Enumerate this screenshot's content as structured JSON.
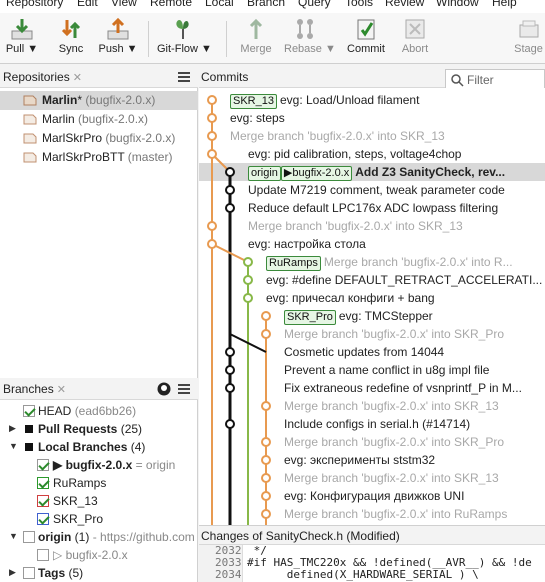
{
  "menu": [
    "Repository",
    "Edit",
    "View",
    "Remote",
    "Local",
    "Branch",
    "Query",
    "Tools",
    "Review",
    "Window",
    "Help"
  ],
  "toolbar": {
    "pull": "Pull ▼",
    "sync": "Sync",
    "push": "Push ▼",
    "gitflow": "Git-Flow ▼",
    "merge": "Merge",
    "rebase": "Rebase ▼",
    "commit": "Commit",
    "abort": "Abort",
    "stage": "Stage"
  },
  "repos": {
    "header": "Repositories",
    "items": [
      {
        "name": "Marlin",
        "mark": "*",
        "branch": "(bugfix-2.0.x)"
      },
      {
        "name": "Marlin",
        "mark": "",
        "branch": "(bugfix-2.0.x)"
      },
      {
        "name": "MarlSkrPro",
        "mark": "",
        "branch": "(bugfix-2.0.x)"
      },
      {
        "name": "MarlSkrProBTT",
        "mark": "",
        "branch": "(master)"
      }
    ]
  },
  "branches": {
    "header": "Branches",
    "head": "HEAD",
    "head_hash": "(ead6bb26)",
    "pull_requests": "Pull Requests",
    "pull_requests_count": "(25)",
    "local_branches": "Local Branches",
    "local_branches_count": "(4)",
    "current": "bugfix-2.0.x",
    "current_suffix": "= origin",
    "others": [
      "RuRamps",
      "SKR_13",
      "SKR_Pro"
    ],
    "origin": "origin",
    "origin_count": "(1)",
    "origin_url": "- https://github.com",
    "origin_branch": "bugfix-2.0.x",
    "tags": "Tags",
    "tags_count": "(5)",
    "colors": {
      "ruramps": "#2c9a2c",
      "skr13": "#d04040",
      "skrpro": "#4060d0"
    }
  },
  "commits": {
    "header": "Commits",
    "filter_placeholder": "Filter",
    "rows": [
      {
        "tag": "SKR_13",
        "msg": "evg: Load/Unload filament",
        "type": "normal"
      },
      {
        "tag": "",
        "msg": "evg: steps",
        "type": "normal"
      },
      {
        "tag": "",
        "msg": "Merge branch 'bugfix-2.0.x' into SKR_13",
        "type": "merge"
      },
      {
        "tag": "",
        "msg": "evg: pid calibration, steps, voltage4chop",
        "type": "normal"
      },
      {
        "tag": "",
        "msg": "Add Z3 SanityCheck, rev...",
        "type": "selected",
        "origin": "origin",
        "head": "bugfix-2.0.x"
      },
      {
        "tag": "",
        "msg": "Update M7219 comment, tweak parameter code",
        "type": "normal"
      },
      {
        "tag": "",
        "msg": "Reduce default LPC176x ADC lowpass filtering",
        "type": "normal"
      },
      {
        "tag": "",
        "msg": "Merge branch 'bugfix-2.0.x' into SKR_13",
        "type": "merge"
      },
      {
        "tag": "",
        "msg": "evg: настройка стола",
        "type": "normal"
      },
      {
        "tag": "RuRamps",
        "msg": "Merge branch 'bugfix-2.0.x' into R...",
        "type": "merge"
      },
      {
        "tag": "",
        "msg": "evg: #define DEFAULT_RETRACT_ACCELERATI...",
        "type": "normal"
      },
      {
        "tag": "",
        "msg": "evg: причесал конфиги + bang",
        "type": "normal"
      },
      {
        "tag": "SKR_Pro",
        "msg": "evg: TMCStepper",
        "type": "normal"
      },
      {
        "tag": "",
        "msg": "Merge branch 'bugfix-2.0.x' into SKR_Pro",
        "type": "merge"
      },
      {
        "tag": "",
        "msg": "Cosmetic updates from 14044",
        "type": "normal"
      },
      {
        "tag": "",
        "msg": "Prevent a name conflict in u8g impl file",
        "type": "normal"
      },
      {
        "tag": "",
        "msg": "Fix extraneous redefine of vsnprintf_P in M...",
        "type": "normal"
      },
      {
        "tag": "",
        "msg": "Merge branch 'bugfix-2.0.x' into SKR_13",
        "type": "merge"
      },
      {
        "tag": "",
        "msg": "Include configs in serial.h (#14714)",
        "type": "normal"
      },
      {
        "tag": "",
        "msg": "Merge branch 'bugfix-2.0.x' into SKR_Pro",
        "type": "merge"
      },
      {
        "tag": "",
        "msg": "evg: эксперименты ststm32",
        "type": "normal"
      },
      {
        "tag": "",
        "msg": "Merge branch 'bugfix-2.0.x' into SKR_13",
        "type": "merge"
      },
      {
        "tag": "",
        "msg": "evg: Конфигурация движков UNI",
        "type": "normal"
      },
      {
        "tag": "",
        "msg": "Merge branch 'bugfix-2.0.x' into RuRamps",
        "type": "merge"
      }
    ]
  },
  "changes": {
    "header": "Changes of SanityCheck.h (Modified)",
    "lines": [
      {
        "num": "2032",
        "text": " */"
      },
      {
        "num": "2033",
        "text": "#if HAS_TMC220x && !defined(__AVR__) && !de"
      },
      {
        "num": "2034",
        "text": "      defined(X_HARDWARE_SERIAL ) \\"
      }
    ]
  },
  "graph_colors": {
    "main": "#111111",
    "orange": "#e89a50",
    "green": "#88b848"
  }
}
